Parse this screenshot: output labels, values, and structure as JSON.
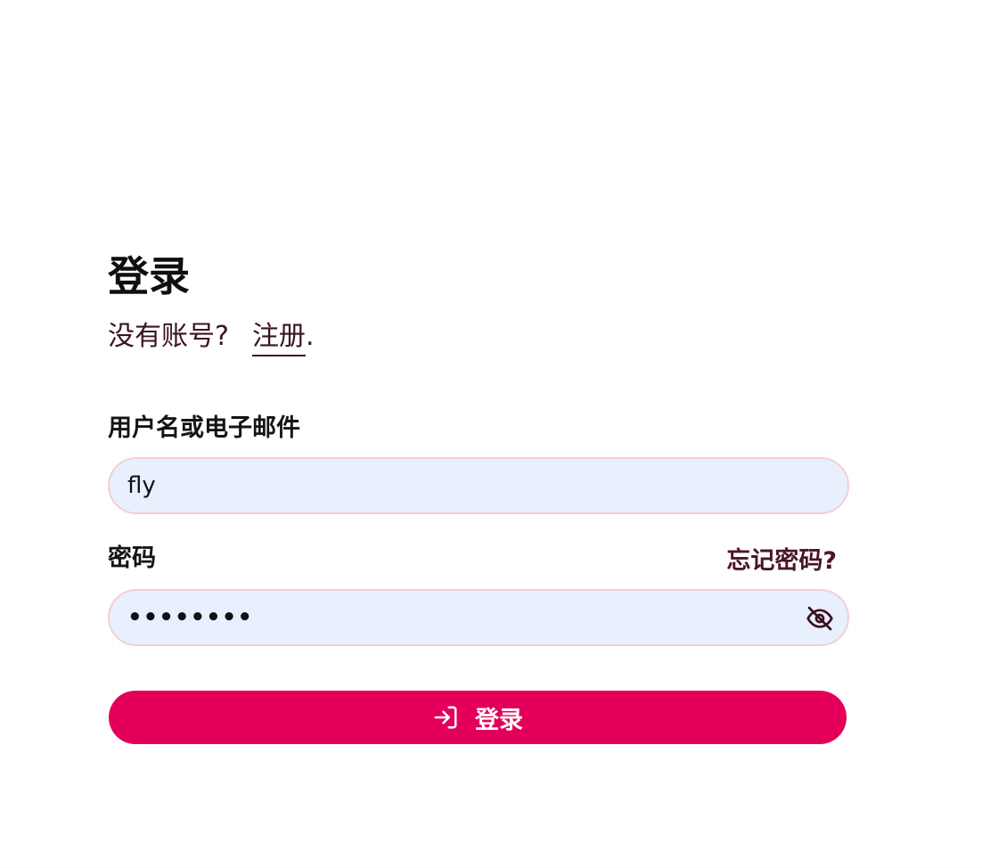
{
  "login": {
    "title": "登录",
    "no_account_text": "没有账号?",
    "signup_link": "注册",
    "signup_suffix": ".",
    "username_label": "用户名或电子邮件",
    "username_value": "fly",
    "password_label": "密码",
    "forgot_password_link": "忘记密码?",
    "password_value": "••••••••",
    "submit_label": "登录",
    "icons": {
      "password_toggle": "eye-off-icon",
      "submit": "login-arrow-icon"
    }
  },
  "colors": {
    "accent": "#e4005a",
    "input_bg": "#e8effd",
    "input_border": "#f5cdd8",
    "link_text": "#3b1422"
  }
}
